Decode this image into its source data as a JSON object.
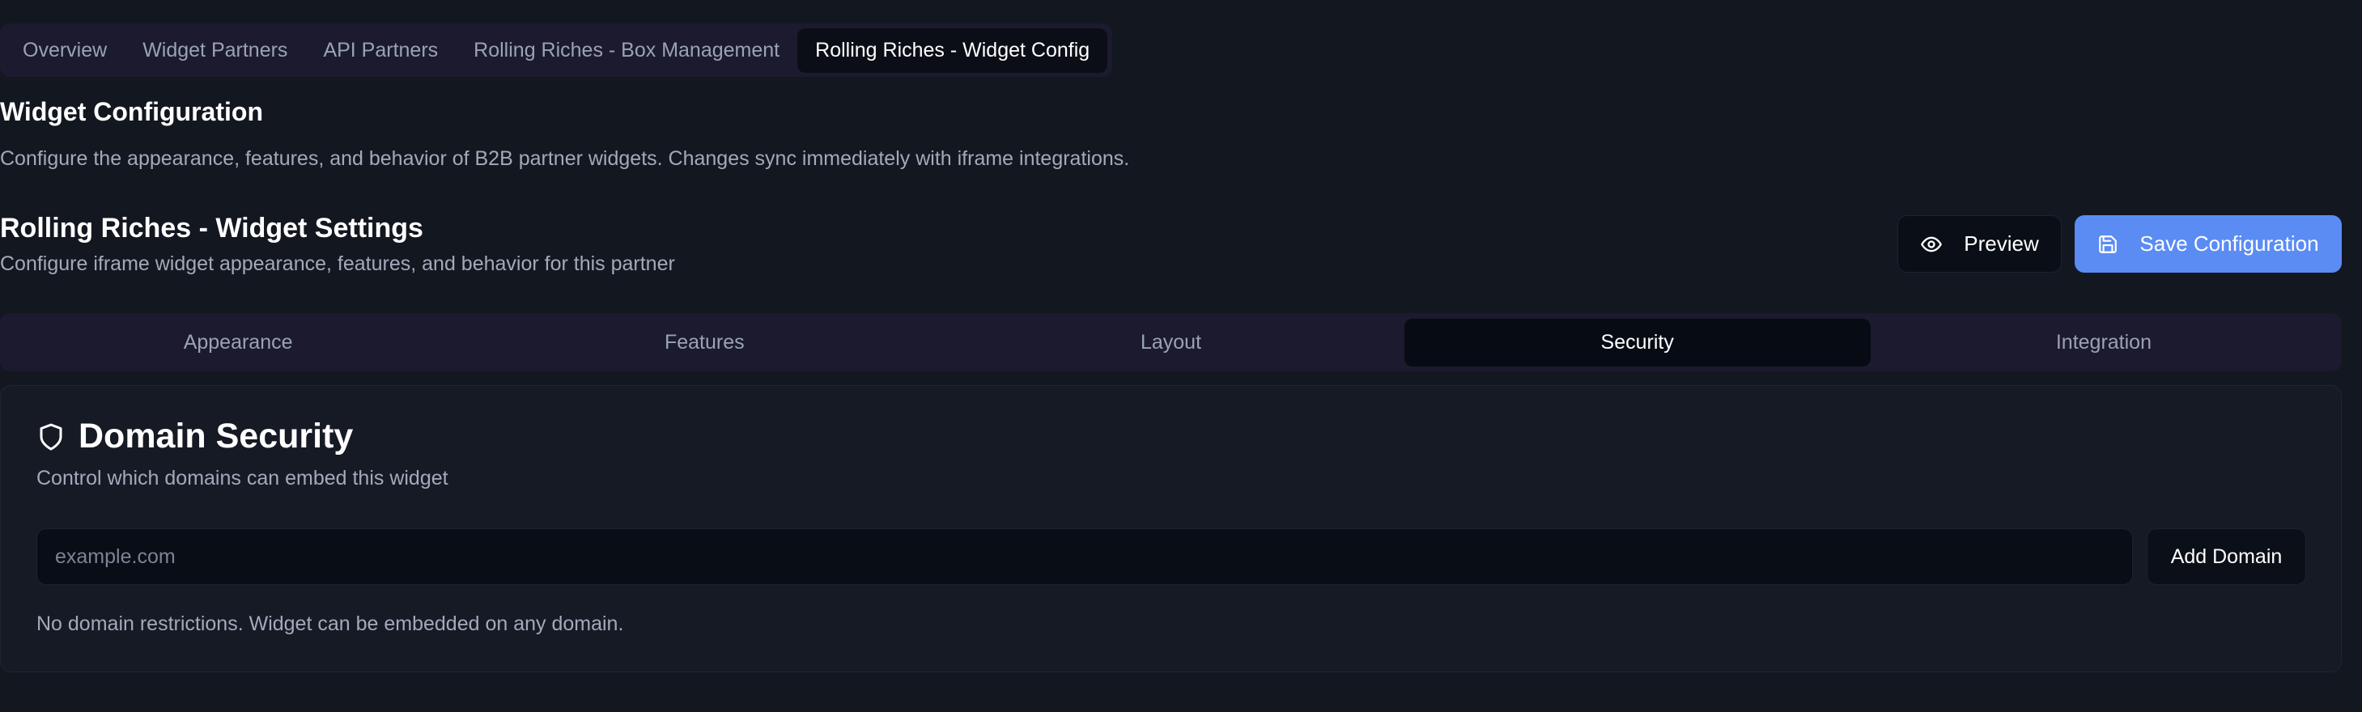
{
  "nav": {
    "tabs": [
      {
        "label": "Overview"
      },
      {
        "label": "Widget Partners"
      },
      {
        "label": "API Partners"
      },
      {
        "label": "Rolling Riches - Box Management"
      },
      {
        "label": "Rolling Riches - Widget Config"
      }
    ],
    "active_tab": "Rolling Riches - Widget Config"
  },
  "page": {
    "title": "Widget Configuration",
    "description": "Configure the appearance, features, and behavior of B2B partner widgets. Changes sync immediately with iframe integrations."
  },
  "section": {
    "title": "Rolling Riches - Widget Settings",
    "description": "Configure iframe widget appearance, features, and behavior for this partner",
    "preview_label": "Preview",
    "save_label": "Save Configuration"
  },
  "settings_tabs": {
    "tabs": [
      {
        "label": "Appearance"
      },
      {
        "label": "Features"
      },
      {
        "label": "Layout"
      },
      {
        "label": "Security"
      },
      {
        "label": "Integration"
      }
    ],
    "active_tab": "Security"
  },
  "security": {
    "icon": "shield-icon",
    "title": "Domain Security",
    "description": "Control which domains can embed this widget",
    "domain_input": {
      "value": "",
      "placeholder": "example.com"
    },
    "add_label": "Add Domain",
    "note": "No domain restrictions. Widget can be embedded on any domain."
  },
  "colors": {
    "background": "#131720",
    "accent": "#5b8cf3",
    "tab_bar": "#1b1a2e",
    "muted_text": "#a2aaba"
  }
}
